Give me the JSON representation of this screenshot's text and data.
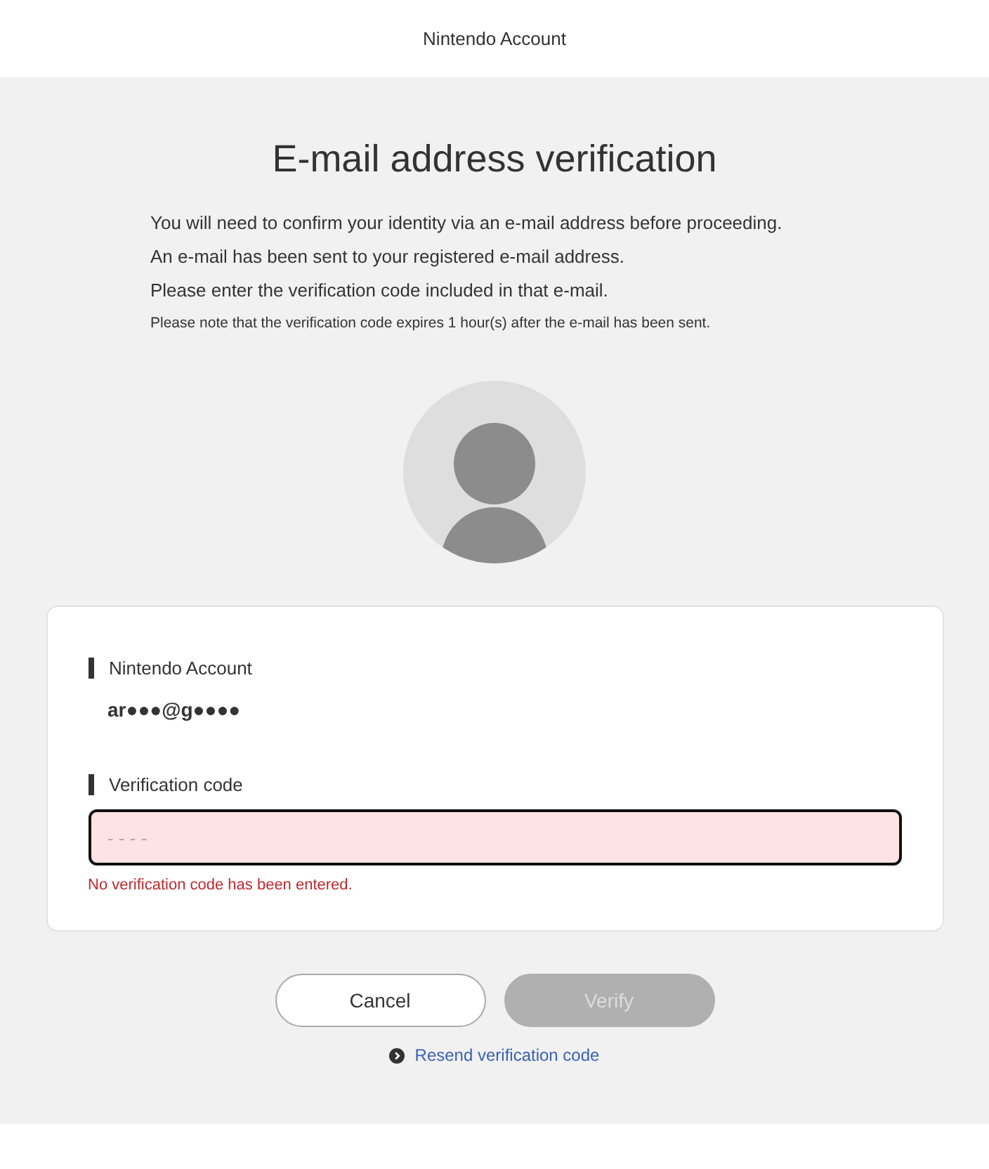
{
  "header": {
    "title": "Nintendo Account"
  },
  "heading": "E-mail address verification",
  "paragraphs": [
    "You will need to confirm your identity via an e-mail address before proceeding.",
    "An e-mail has been sent to your registered e-mail address.",
    "Please enter the verification code included in that e-mail."
  ],
  "note": "Please note that the verification code expires 1 hour(s) after the e-mail has been sent.",
  "account": {
    "label": "Nintendo Account",
    "value": "ar●●●@g●●●●"
  },
  "code_field": {
    "label": "Verification code",
    "placeholder": "- - - -",
    "invalid": true,
    "error": "No verification code has been entered."
  },
  "buttons": [
    {
      "label": "Cancel",
      "disabled": false
    },
    {
      "label": "Verify",
      "disabled": true
    }
  ],
  "resend_link": "Resend verification code"
}
